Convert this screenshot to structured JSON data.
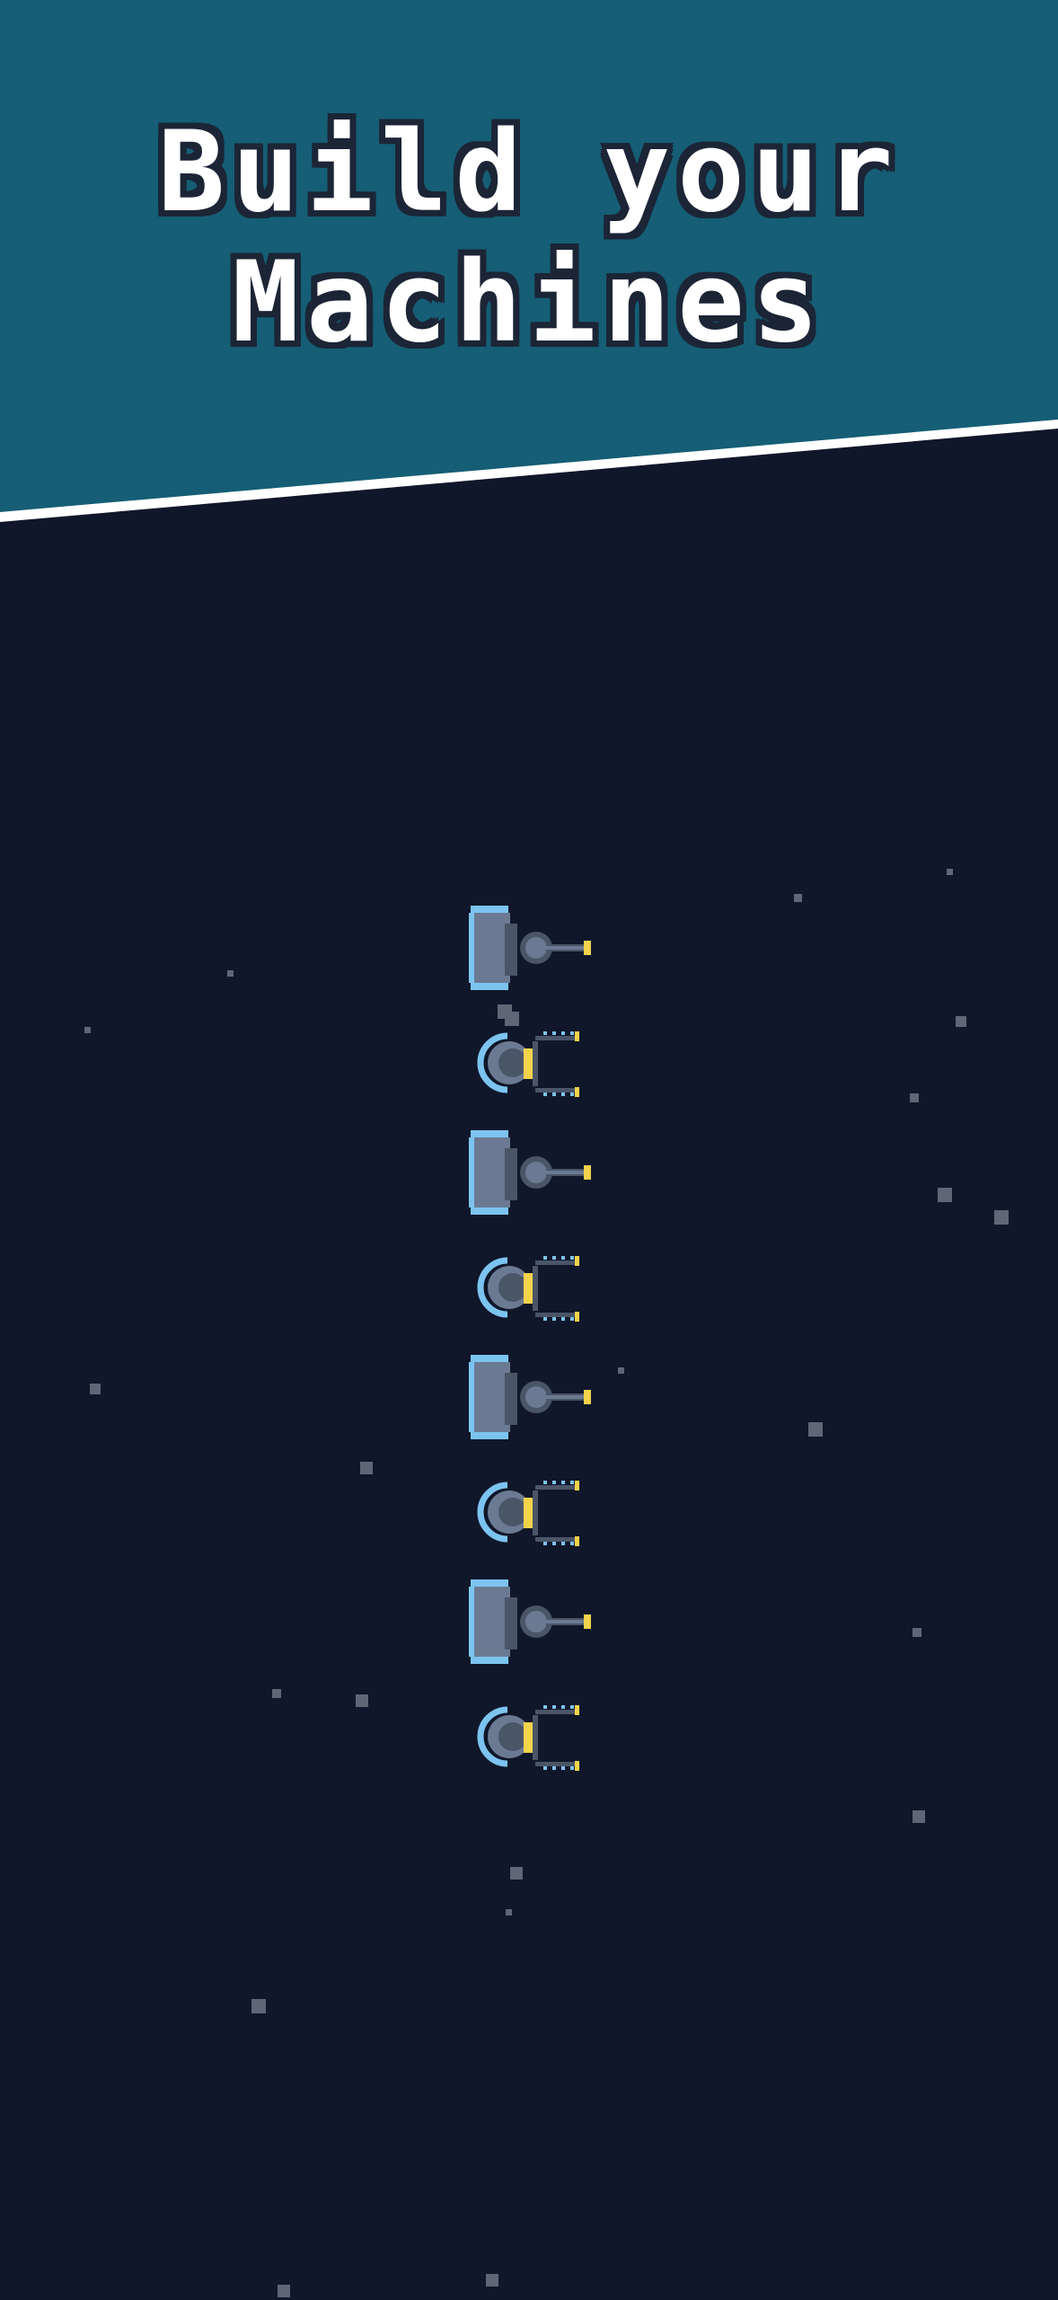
{
  "banner": {
    "title_line_1": "Build your",
    "title_line_2": "Machines"
  },
  "colors": {
    "background": "#11172a",
    "banner": "#155e75",
    "divider": "#ffffff",
    "title_text": "#ffffff",
    "title_outline": "#1b2536",
    "star": "#5f6675",
    "machine_body": "#6b7a92",
    "machine_shadow": "#4a5568",
    "machine_glow": "#7cc4f0",
    "machine_accent": "#f2d34a"
  },
  "machines": [
    {
      "type": "cannon-turret"
    },
    {
      "type": "grabber-drone"
    },
    {
      "type": "cannon-turret"
    },
    {
      "type": "grabber-drone"
    },
    {
      "type": "cannon-turret"
    },
    {
      "type": "grabber-drone"
    },
    {
      "type": "cannon-turret"
    },
    {
      "type": "grabber-drone"
    }
  ],
  "icons": {
    "cannon": "cannon-turret-icon",
    "grabber": "grabber-drone-icon",
    "star": "star-particle"
  }
}
